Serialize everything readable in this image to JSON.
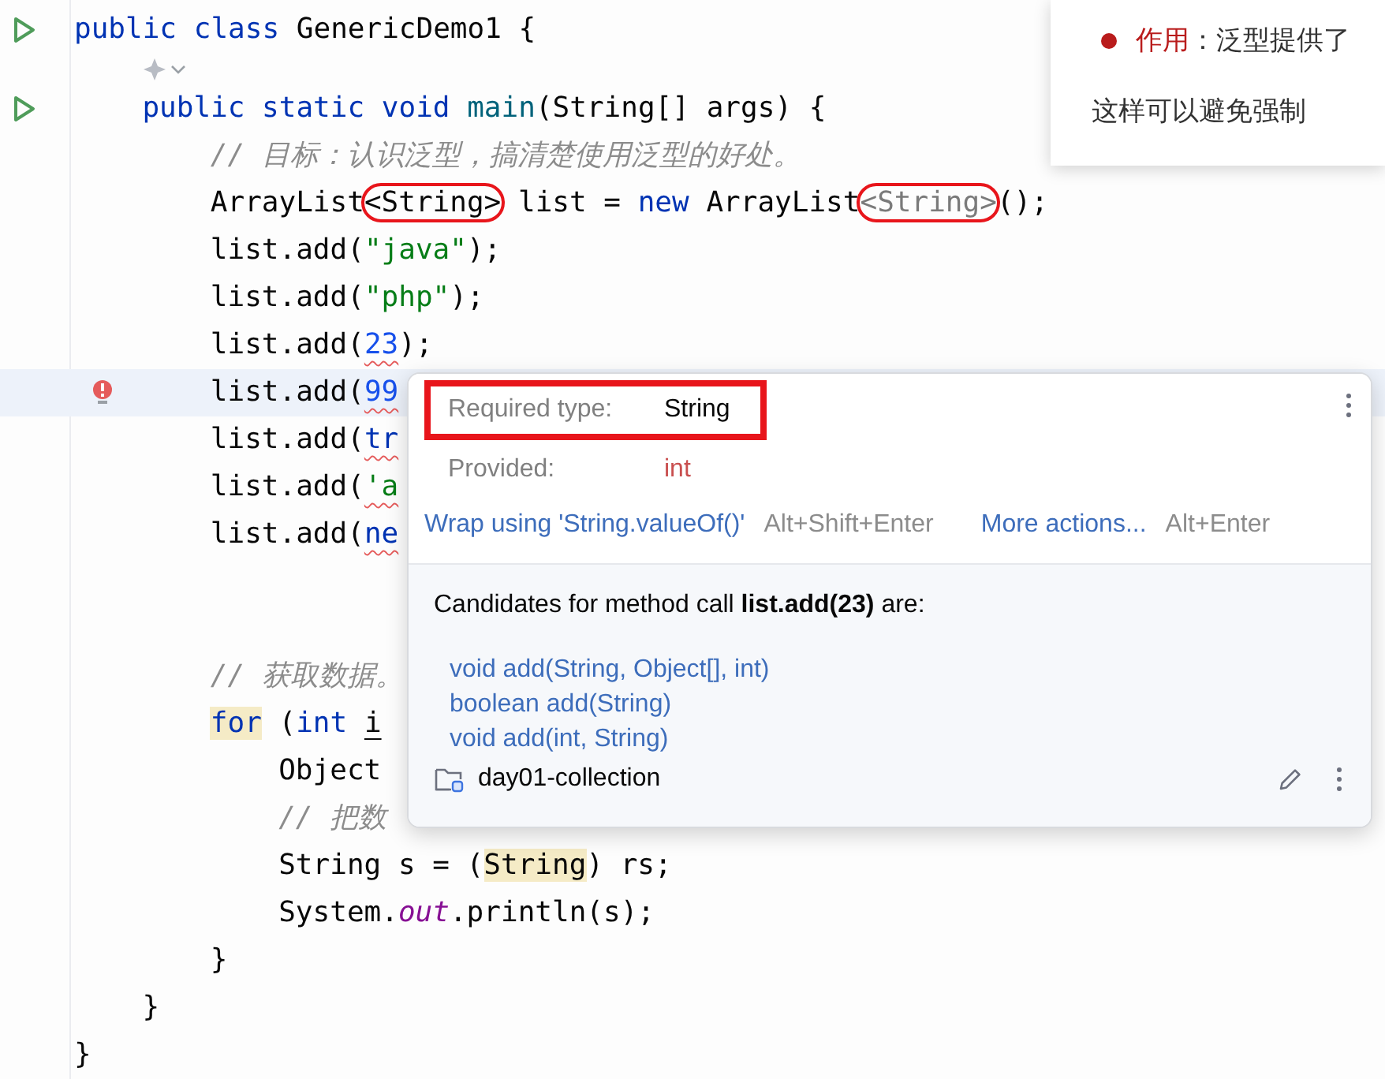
{
  "editor": {
    "lines": [
      {
        "kind": "code",
        "runnable": true,
        "has_error": false,
        "current": false,
        "tokens": [
          {
            "kind": "keyword",
            "text": "public class "
          },
          {
            "kind": "plain",
            "text": "GenericDemo1 {"
          }
        ],
        "children": [
          {
            "kind": "hint"
          },
          {
            "kind": "code",
            "runnable": true,
            "has_error": false,
            "current": false,
            "tokens": [
              {
                "kind": "keyword",
                "text": "public static void "
              },
              {
                "kind": "method",
                "text": "main"
              },
              {
                "kind": "plain",
                "text": "(String[] args) {"
              }
            ],
            "children": [
              {
                "kind": "code",
                "runnable": false,
                "has_error": false,
                "current": false,
                "tokens": [
                  {
                    "kind": "comment",
                    "text": "// 目标：认识泛型，搞清楚使用泛型的好处。"
                  }
                ]
              },
              {
                "kind": "code",
                "runnable": false,
                "has_error": false,
                "current": false,
                "tokens": [
                  {
                    "kind": "plain",
                    "text": "ArrayList"
                  },
                  {
                    "kind": "plain",
                    "text": "<String>",
                    "circled": true
                  },
                  {
                    "kind": "plain",
                    "text": " list = "
                  },
                  {
                    "kind": "keyword",
                    "text": "new"
                  },
                  {
                    "kind": "plain",
                    "text": " ArrayList"
                  },
                  {
                    "kind": "muted",
                    "text": "<String>",
                    "circled": true
                  },
                  {
                    "kind": "plain",
                    "text": "();"
                  }
                ]
              },
              {
                "kind": "code",
                "runnable": false,
                "has_error": false,
                "current": false,
                "tokens": [
                  {
                    "kind": "plain",
                    "text": "list.add("
                  },
                  {
                    "kind": "string",
                    "text": "\"java\""
                  },
                  {
                    "kind": "plain",
                    "text": ");"
                  }
                ]
              },
              {
                "kind": "code",
                "runnable": false,
                "has_error": false,
                "current": false,
                "tokens": [
                  {
                    "kind": "plain",
                    "text": "list.add("
                  },
                  {
                    "kind": "string",
                    "text": "\"php\""
                  },
                  {
                    "kind": "plain",
                    "text": ");"
                  }
                ]
              },
              {
                "kind": "code",
                "runnable": false,
                "has_error": false,
                "current": false,
                "tokens": [
                  {
                    "kind": "plain",
                    "text": "list.add("
                  },
                  {
                    "kind": "number",
                    "text": "23",
                    "error": true
                  },
                  {
                    "kind": "plain",
                    "text": ");"
                  }
                ]
              },
              {
                "kind": "code",
                "runnable": false,
                "has_error": true,
                "current": true,
                "tokens": [
                  {
                    "kind": "plain",
                    "text": "list.add("
                  },
                  {
                    "kind": "number",
                    "text": "99",
                    "error": true
                  }
                ]
              },
              {
                "kind": "code",
                "runnable": false,
                "has_error": false,
                "current": false,
                "tokens": [
                  {
                    "kind": "plain",
                    "text": "list.add("
                  },
                  {
                    "kind": "keyword",
                    "text": "tr",
                    "error": true
                  }
                ]
              },
              {
                "kind": "code",
                "runnable": false,
                "has_error": false,
                "current": false,
                "tokens": [
                  {
                    "kind": "plain",
                    "text": "list.add("
                  },
                  {
                    "kind": "string",
                    "text": "'a",
                    "error": true
                  }
                ]
              },
              {
                "kind": "code",
                "runnable": false,
                "has_error": false,
                "current": false,
                "tokens": [
                  {
                    "kind": "plain",
                    "text": "list.add("
                  },
                  {
                    "kind": "keyword",
                    "text": "ne",
                    "error": true
                  }
                ]
              },
              {
                "kind": "blank"
              },
              {
                "kind": "blank"
              },
              {
                "kind": "code",
                "runnable": false,
                "has_error": false,
                "current": false,
                "tokens": [
                  {
                    "kind": "comment",
                    "text": "// 获取数据。"
                  }
                ]
              },
              {
                "kind": "code",
                "runnable": false,
                "has_error": false,
                "current": false,
                "tokens": [
                  {
                    "kind": "keyword",
                    "text": "for",
                    "highlighted": true
                  },
                  {
                    "kind": "plain",
                    "text": " ("
                  },
                  {
                    "kind": "keyword",
                    "text": "int "
                  },
                  {
                    "kind": "plain",
                    "text": "i",
                    "underlined": true
                  }
                ],
                "children": [
                  {
                    "kind": "code",
                    "runnable": false,
                    "has_error": false,
                    "current": false,
                    "tokens": [
                      {
                        "kind": "plain",
                        "text": "Object"
                      }
                    ]
                  },
                  {
                    "kind": "code",
                    "runnable": false,
                    "has_error": false,
                    "current": false,
                    "tokens": [
                      {
                        "kind": "comment",
                        "text": "// 把数"
                      }
                    ]
                  },
                  {
                    "kind": "code",
                    "runnable": false,
                    "has_error": false,
                    "current": false,
                    "tokens": [
                      {
                        "kind": "plain",
                        "text": "String s = ("
                      },
                      {
                        "kind": "plain",
                        "text": "String",
                        "highlighted": true
                      },
                      {
                        "kind": "plain",
                        "text": ") rs;"
                      }
                    ]
                  },
                  {
                    "kind": "code",
                    "runnable": false,
                    "has_error": false,
                    "current": false,
                    "tokens": [
                      {
                        "kind": "plain",
                        "text": "System."
                      },
                      {
                        "kind": "field",
                        "text": "out"
                      },
                      {
                        "kind": "plain",
                        "text": ".println(s);"
                      }
                    ]
                  }
                ]
              },
              {
                "kind": "code",
                "runnable": false,
                "has_error": false,
                "current": false,
                "tokens": [
                  {
                    "kind": "plain",
                    "text": "}"
                  }
                ]
              }
            ]
          },
          {
            "kind": "code",
            "runnable": false,
            "has_error": false,
            "current": false,
            "tokens": [
              {
                "kind": "plain",
                "text": "}"
              }
            ]
          }
        ]
      },
      {
        "kind": "code",
        "runnable": false,
        "has_error": false,
        "current": false,
        "tokens": [
          {
            "kind": "plain",
            "text": "}"
          }
        ]
      }
    ]
  },
  "notification": {
    "term": "作用",
    "text": "：泛型提供了",
    "line_2": "这样可以避免强制"
  },
  "popup": {
    "rows": [
      {
        "label": "Required type:",
        "value": "String",
        "kind": "normal",
        "framed": true
      },
      {
        "label": "Provided:",
        "value": "int",
        "kind": "error",
        "framed": false
      }
    ],
    "actions": [
      {
        "label": "Wrap using 'String.valueOf()'",
        "shortcut": "Alt+Shift+Enter"
      },
      {
        "label": "More actions...",
        "shortcut": "Alt+Enter"
      }
    ],
    "candidates_title": "Candidates for method call **list.add(23)** are:",
    "candidates": [
      "void add(String, Object[], int)",
      "boolean add(String)",
      "void add(int, String)"
    ],
    "module": "day01-collection"
  }
}
